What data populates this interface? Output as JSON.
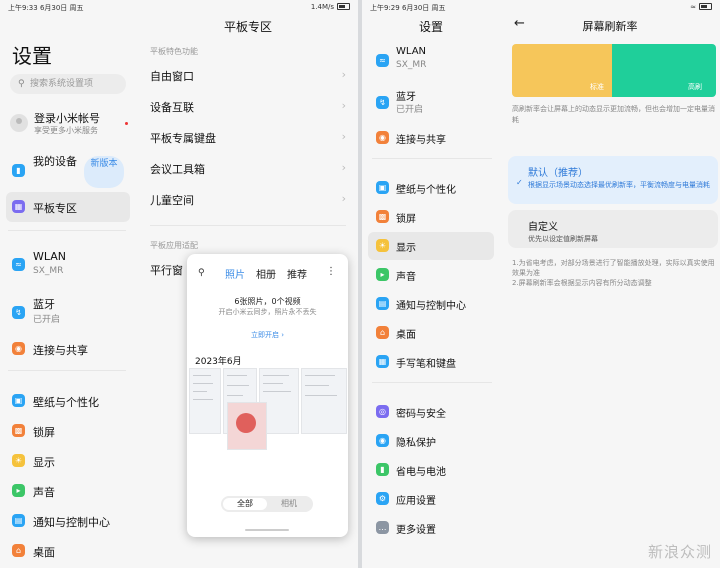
{
  "left": {
    "status": {
      "time": "上午9:33 6月30日 周五",
      "right": "1.4M/s"
    },
    "title": "设置",
    "search_placeholder": "搜索系统设置项",
    "account": {
      "name": "登录小米帐号",
      "sub": "享受更多小米服务"
    },
    "items": [
      {
        "label": "我的设备",
        "badge": "新版本"
      },
      {
        "label": "平板专区"
      },
      {
        "label": "WLAN",
        "sub": "SX_MR"
      },
      {
        "label": "蓝牙",
        "sub": "已开启"
      },
      {
        "label": "连接与共享"
      },
      {
        "label": "壁纸与个性化"
      },
      {
        "label": "锁屏"
      },
      {
        "label": "显示"
      },
      {
        "label": "声音"
      },
      {
        "label": "通知与控制中心"
      },
      {
        "label": "桌面"
      }
    ],
    "zone": {
      "title": "平板专区",
      "section1": "平板特色功能",
      "rows1": [
        "自由窗口",
        "设备互联",
        "平板专属键盘",
        "会议工具箱",
        "儿童空间"
      ],
      "section2": "平板应用适配",
      "rows2": [
        "平行窗"
      ]
    },
    "popup": {
      "tabs": [
        "照片",
        "相册",
        "推荐"
      ],
      "info": "6张照片，0个视频",
      "info_sub": "开启小米云同步，照片永不丢失",
      "link": "立即开启 ›",
      "month": "2023年6月",
      "toggle": [
        "全部",
        "相机"
      ]
    }
  },
  "right": {
    "status": {
      "time": "上午9:29 6月30日 周五"
    },
    "title": "设置",
    "items": [
      {
        "label": "WLAN",
        "sub": "SX_MR"
      },
      {
        "label": "蓝牙",
        "sub": "已开启"
      },
      {
        "label": "连接与共享"
      },
      {
        "label": "壁纸与个性化"
      },
      {
        "label": "锁屏"
      },
      {
        "label": "显示"
      },
      {
        "label": "声音"
      },
      {
        "label": "通知与控制中心"
      },
      {
        "label": "桌面"
      },
      {
        "label": "手写笔和键盘"
      },
      {
        "label": "密码与安全"
      },
      {
        "label": "隐私保护"
      },
      {
        "label": "省电与电池"
      },
      {
        "label": "应用设置"
      },
      {
        "label": "更多设置"
      }
    ],
    "detail": {
      "title": "屏幕刷新率",
      "preview_labels": [
        "标准",
        "高刷"
      ],
      "desc": "高刷新率会让屏幕上的动态显示更加流畅，但也会增加一定电量消耗",
      "option1": {
        "title": "默认（推荐）",
        "sub": "根据显示场景动态选择最优刷新率，平衡流畅度与电量消耗"
      },
      "option2": {
        "title": "自定义",
        "sub": "优先以设定值刷新屏幕"
      },
      "notes": "1.为省电考虑，对部分场景进行了智能播放处理，实际以真实使用效果为准\n2.屏幕刷新率会根据显示内容有所分动态调整"
    }
  },
  "watermark": "新浪众测",
  "colors": {
    "accent": "#3a8be6",
    "preview_yellow": "#f6c65a",
    "preview_green": "#1fcf9a"
  }
}
